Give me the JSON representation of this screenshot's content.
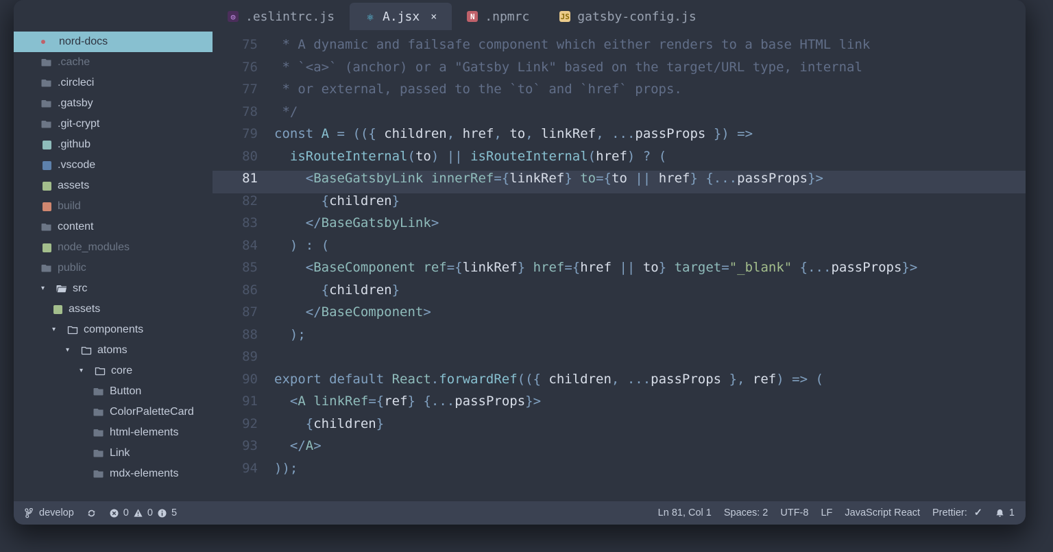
{
  "tabs": {
    "items": [
      {
        "icon": "eslint-icon",
        "label": ".eslintrc.js",
        "active": false
      },
      {
        "icon": "react-icon",
        "label": "A.jsx",
        "active": true,
        "closeable": true
      },
      {
        "icon": "npm-icon",
        "label": ".npmrc",
        "active": false
      },
      {
        "icon": "js-icon",
        "label": "gatsby-config.js",
        "active": false
      }
    ]
  },
  "sidebar": {
    "root": "nord-docs",
    "entries": [
      {
        "label": ".cache",
        "kind": "folder",
        "dim": true,
        "indent": 1
      },
      {
        "label": ".circleci",
        "kind": "folder",
        "dim": false,
        "indent": 1
      },
      {
        "label": ".gatsby",
        "kind": "folder",
        "dim": false,
        "indent": 1
      },
      {
        "label": ".git-crypt",
        "kind": "folder",
        "dim": false,
        "indent": 1
      },
      {
        "label": ".github",
        "kind": "folder",
        "dim": false,
        "indent": 1,
        "badge": "cyan"
      },
      {
        "label": ".vscode",
        "kind": "folder",
        "dim": false,
        "indent": 1,
        "badge": "blue"
      },
      {
        "label": "assets",
        "kind": "folder",
        "dim": false,
        "indent": 1,
        "badge": "green"
      },
      {
        "label": "build",
        "kind": "folder",
        "dim": true,
        "indent": 1,
        "badge": "orange"
      },
      {
        "label": "content",
        "kind": "folder",
        "dim": false,
        "indent": 1
      },
      {
        "label": "node_modules",
        "kind": "folder",
        "dim": true,
        "indent": 1,
        "badge": "green"
      },
      {
        "label": "public",
        "kind": "folder",
        "dim": true,
        "indent": 1
      },
      {
        "label": "src",
        "kind": "folder-open",
        "dim": false,
        "indent": 1,
        "chevron": "open"
      },
      {
        "label": "assets",
        "kind": "folder",
        "dim": false,
        "indent": 2,
        "badge": "green"
      },
      {
        "label": "components",
        "kind": "folder-open-line",
        "dim": false,
        "indent": 2,
        "chevron": "open"
      },
      {
        "label": "atoms",
        "kind": "folder-open-line",
        "dim": false,
        "indent": 3,
        "chevron": "open"
      },
      {
        "label": "core",
        "kind": "folder-open-line",
        "dim": false,
        "indent": 4,
        "chevron": "open"
      },
      {
        "label": "Button",
        "kind": "folder",
        "dim": false,
        "indent": 5
      },
      {
        "label": "ColorPaletteCard",
        "kind": "folder",
        "dim": false,
        "indent": 5
      },
      {
        "label": "html-elements",
        "kind": "folder",
        "dim": false,
        "indent": 5
      },
      {
        "label": "Link",
        "kind": "folder",
        "dim": false,
        "indent": 5
      },
      {
        "label": "mdx-elements",
        "kind": "folder",
        "dim": false,
        "indent": 5
      }
    ]
  },
  "editor": {
    "current_line": 81,
    "lines": [
      {
        "n": 75,
        "tokens": [
          [
            "t-comment",
            " * A dynamic and failsafe component which either renders to a base HTML link"
          ]
        ]
      },
      {
        "n": 76,
        "tokens": [
          [
            "t-comment",
            " * `<a>` (anchor) or a \"Gatsby Link\" based on the target/URL type, internal"
          ]
        ]
      },
      {
        "n": 77,
        "tokens": [
          [
            "t-comment",
            " * or external, passed to the `to` and `href` props."
          ]
        ]
      },
      {
        "n": 78,
        "tokens": [
          [
            "t-comment",
            " */"
          ]
        ]
      },
      {
        "n": 79,
        "tokens": [
          [
            "t-kw",
            "const "
          ],
          [
            "t-fn",
            "A"
          ],
          [
            "t-plain",
            " "
          ],
          [
            "t-punc",
            "="
          ],
          [
            "t-plain",
            " "
          ],
          [
            "t-punc",
            "(({ "
          ],
          [
            "t-var",
            "children"
          ],
          [
            "t-punc",
            ","
          ],
          [
            "t-plain",
            " "
          ],
          [
            "t-var",
            "href"
          ],
          [
            "t-punc",
            ","
          ],
          [
            "t-plain",
            " "
          ],
          [
            "t-var",
            "to"
          ],
          [
            "t-punc",
            ","
          ],
          [
            "t-plain",
            " "
          ],
          [
            "t-var",
            "linkRef"
          ],
          [
            "t-punc",
            ","
          ],
          [
            "t-plain",
            " "
          ],
          [
            "t-punc",
            "..."
          ],
          [
            "t-var",
            "passProps"
          ],
          [
            "t-plain",
            " "
          ],
          [
            "t-punc",
            "})"
          ],
          [
            "t-plain",
            " "
          ],
          [
            "t-punc",
            "=>"
          ]
        ]
      },
      {
        "n": 80,
        "tokens": [
          [
            "t-plain",
            "  "
          ],
          [
            "t-fn",
            "isRouteInternal"
          ],
          [
            "t-punc",
            "("
          ],
          [
            "t-var",
            "to"
          ],
          [
            "t-punc",
            ")"
          ],
          [
            "t-plain",
            " "
          ],
          [
            "t-punc",
            "||"
          ],
          [
            "t-plain",
            " "
          ],
          [
            "t-fn",
            "isRouteInternal"
          ],
          [
            "t-punc",
            "("
          ],
          [
            "t-var",
            "href"
          ],
          [
            "t-punc",
            ")"
          ],
          [
            "t-plain",
            " "
          ],
          [
            "t-punc",
            "?"
          ],
          [
            "t-plain",
            " "
          ],
          [
            "t-punc",
            "("
          ]
        ]
      },
      {
        "n": 81,
        "tokens": [
          [
            "t-plain",
            "    "
          ],
          [
            "t-tag",
            "<"
          ],
          [
            "t-comp",
            "BaseGatsbyLink"
          ],
          [
            "t-plain",
            " "
          ],
          [
            "t-attr",
            "innerRef"
          ],
          [
            "t-punc",
            "={"
          ],
          [
            "t-var",
            "linkRef"
          ],
          [
            "t-punc",
            "}"
          ],
          [
            "t-plain",
            " "
          ],
          [
            "t-attr",
            "to"
          ],
          [
            "t-punc",
            "={"
          ],
          [
            "t-var",
            "to"
          ],
          [
            "t-plain",
            " "
          ],
          [
            "t-punc",
            "||"
          ],
          [
            "t-plain",
            " "
          ],
          [
            "t-var",
            "href"
          ],
          [
            "t-punc",
            "}"
          ],
          [
            "t-plain",
            " "
          ],
          [
            "t-punc",
            "{..."
          ],
          [
            "t-var",
            "passProps"
          ],
          [
            "t-punc",
            "}"
          ],
          [
            "t-tag",
            ">"
          ]
        ]
      },
      {
        "n": 82,
        "tokens": [
          [
            "t-plain",
            "      "
          ],
          [
            "t-punc",
            "{"
          ],
          [
            "t-var",
            "children"
          ],
          [
            "t-punc",
            "}"
          ]
        ]
      },
      {
        "n": 83,
        "tokens": [
          [
            "t-plain",
            "    "
          ],
          [
            "t-tag",
            "</"
          ],
          [
            "t-comp",
            "BaseGatsbyLink"
          ],
          [
            "t-tag",
            ">"
          ]
        ]
      },
      {
        "n": 84,
        "tokens": [
          [
            "t-plain",
            "  "
          ],
          [
            "t-punc",
            ")"
          ],
          [
            "t-plain",
            " "
          ],
          [
            "t-punc",
            ":"
          ],
          [
            "t-plain",
            " "
          ],
          [
            "t-punc",
            "("
          ]
        ]
      },
      {
        "n": 85,
        "tokens": [
          [
            "t-plain",
            "    "
          ],
          [
            "t-tag",
            "<"
          ],
          [
            "t-comp",
            "BaseComponent"
          ],
          [
            "t-plain",
            " "
          ],
          [
            "t-attr",
            "ref"
          ],
          [
            "t-punc",
            "={"
          ],
          [
            "t-var",
            "linkRef"
          ],
          [
            "t-punc",
            "}"
          ],
          [
            "t-plain",
            " "
          ],
          [
            "t-attr",
            "href"
          ],
          [
            "t-punc",
            "={"
          ],
          [
            "t-var",
            "href"
          ],
          [
            "t-plain",
            " "
          ],
          [
            "t-punc",
            "||"
          ],
          [
            "t-plain",
            " "
          ],
          [
            "t-var",
            "to"
          ],
          [
            "t-punc",
            "}"
          ],
          [
            "t-plain",
            " "
          ],
          [
            "t-attr",
            "target"
          ],
          [
            "t-punc",
            "="
          ],
          [
            "t-str",
            "\"_blank\""
          ],
          [
            "t-plain",
            " "
          ],
          [
            "t-punc",
            "{..."
          ],
          [
            "t-var",
            "passProps"
          ],
          [
            "t-punc",
            "}"
          ],
          [
            "t-tag",
            ">"
          ]
        ]
      },
      {
        "n": 86,
        "tokens": [
          [
            "t-plain",
            "      "
          ],
          [
            "t-punc",
            "{"
          ],
          [
            "t-var",
            "children"
          ],
          [
            "t-punc",
            "}"
          ]
        ]
      },
      {
        "n": 87,
        "tokens": [
          [
            "t-plain",
            "    "
          ],
          [
            "t-tag",
            "</"
          ],
          [
            "t-comp",
            "BaseComponent"
          ],
          [
            "t-tag",
            ">"
          ]
        ]
      },
      {
        "n": 88,
        "tokens": [
          [
            "t-plain",
            "  "
          ],
          [
            "t-punc",
            ");"
          ]
        ]
      },
      {
        "n": 89,
        "tokens": [
          [
            "t-plain",
            ""
          ]
        ]
      },
      {
        "n": 90,
        "tokens": [
          [
            "t-kw",
            "export default "
          ],
          [
            "t-obj",
            "React"
          ],
          [
            "t-punc",
            "."
          ],
          [
            "t-fn",
            "forwardRef"
          ],
          [
            "t-punc",
            "(({ "
          ],
          [
            "t-var",
            "children"
          ],
          [
            "t-punc",
            ","
          ],
          [
            "t-plain",
            " "
          ],
          [
            "t-punc",
            "..."
          ],
          [
            "t-var",
            "passProps"
          ],
          [
            "t-plain",
            " "
          ],
          [
            "t-punc",
            "},"
          ],
          [
            "t-plain",
            " "
          ],
          [
            "t-var",
            "ref"
          ],
          [
            "t-punc",
            ")"
          ],
          [
            "t-plain",
            " "
          ],
          [
            "t-punc",
            "=>"
          ],
          [
            "t-plain",
            " "
          ],
          [
            "t-punc",
            "("
          ]
        ]
      },
      {
        "n": 91,
        "tokens": [
          [
            "t-plain",
            "  "
          ],
          [
            "t-tag",
            "<"
          ],
          [
            "t-comp",
            "A"
          ],
          [
            "t-plain",
            " "
          ],
          [
            "t-attr",
            "linkRef"
          ],
          [
            "t-punc",
            "={"
          ],
          [
            "t-var",
            "ref"
          ],
          [
            "t-punc",
            "}"
          ],
          [
            "t-plain",
            " "
          ],
          [
            "t-punc",
            "{..."
          ],
          [
            "t-var",
            "passProps"
          ],
          [
            "t-punc",
            "}"
          ],
          [
            "t-tag",
            ">"
          ]
        ]
      },
      {
        "n": 92,
        "tokens": [
          [
            "t-plain",
            "    "
          ],
          [
            "t-punc",
            "{"
          ],
          [
            "t-var",
            "children"
          ],
          [
            "t-punc",
            "}"
          ]
        ]
      },
      {
        "n": 93,
        "tokens": [
          [
            "t-plain",
            "  "
          ],
          [
            "t-tag",
            "</"
          ],
          [
            "t-comp",
            "A"
          ],
          [
            "t-tag",
            ">"
          ]
        ]
      },
      {
        "n": 94,
        "tokens": [
          [
            "t-punc",
            "));"
          ]
        ]
      }
    ]
  },
  "status": {
    "branch": "develop",
    "errors": "0",
    "warnings": "0",
    "info": "5",
    "cursor": "Ln 81, Col 1",
    "indent": "Spaces: 2",
    "encoding": "UTF-8",
    "eol": "LF",
    "language": "JavaScript React",
    "prettier": "Prettier:",
    "notifications": "1"
  }
}
